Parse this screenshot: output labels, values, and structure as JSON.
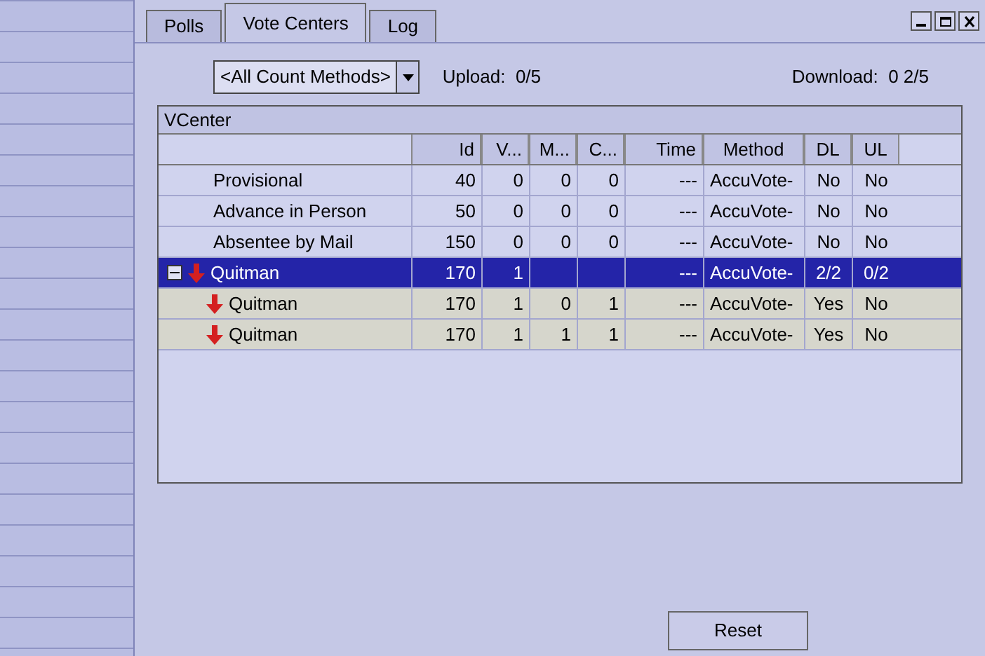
{
  "tabs": [
    {
      "label": "Polls",
      "selected": false
    },
    {
      "label": "Vote Centers",
      "selected": true
    },
    {
      "label": "Log",
      "selected": false
    }
  ],
  "filter": {
    "value": "<All Count Methods>"
  },
  "upload": "Upload:  0/5",
  "download": "Download:  0 2/5",
  "table": {
    "title": "VCenter",
    "columns": [
      "Id",
      "V...",
      "M...",
      "C...",
      "Time",
      "Method",
      "DL",
      "UL"
    ],
    "rows": [
      {
        "name": "Provisional",
        "cells": [
          "40",
          "0",
          "0",
          "0",
          "---",
          "AccuVote-",
          "No",
          "No"
        ],
        "selected": false,
        "icon": false
      },
      {
        "name": "Advance in Person",
        "cells": [
          "50",
          "0",
          "0",
          "0",
          "---",
          "AccuVote-",
          "No",
          "No"
        ],
        "selected": false,
        "icon": false
      },
      {
        "name": "Absentee by Mail",
        "cells": [
          "150",
          "0",
          "0",
          "0",
          "---",
          "AccuVote-",
          "No",
          "No"
        ],
        "selected": false,
        "icon": false
      },
      {
        "name": "Quitman",
        "cells": [
          "170",
          "1",
          "",
          "",
          "---",
          "AccuVote-",
          "2/2",
          "0/2"
        ],
        "selected": true,
        "icon": true,
        "expanded": true,
        "children": [
          {
            "name": "Quitman",
            "cells": [
              "170",
              "1",
              "0",
              "1",
              "---",
              "AccuVote-",
              "Yes",
              "No"
            ],
            "selected": false,
            "icon": true
          },
          {
            "name": "Quitman",
            "cells": [
              "170",
              "1",
              "1",
              "1",
              "---",
              "AccuVote-",
              "Yes",
              "No"
            ],
            "selected": false,
            "icon": true
          }
        ]
      }
    ]
  },
  "buttons": [
    "Reset"
  ]
}
